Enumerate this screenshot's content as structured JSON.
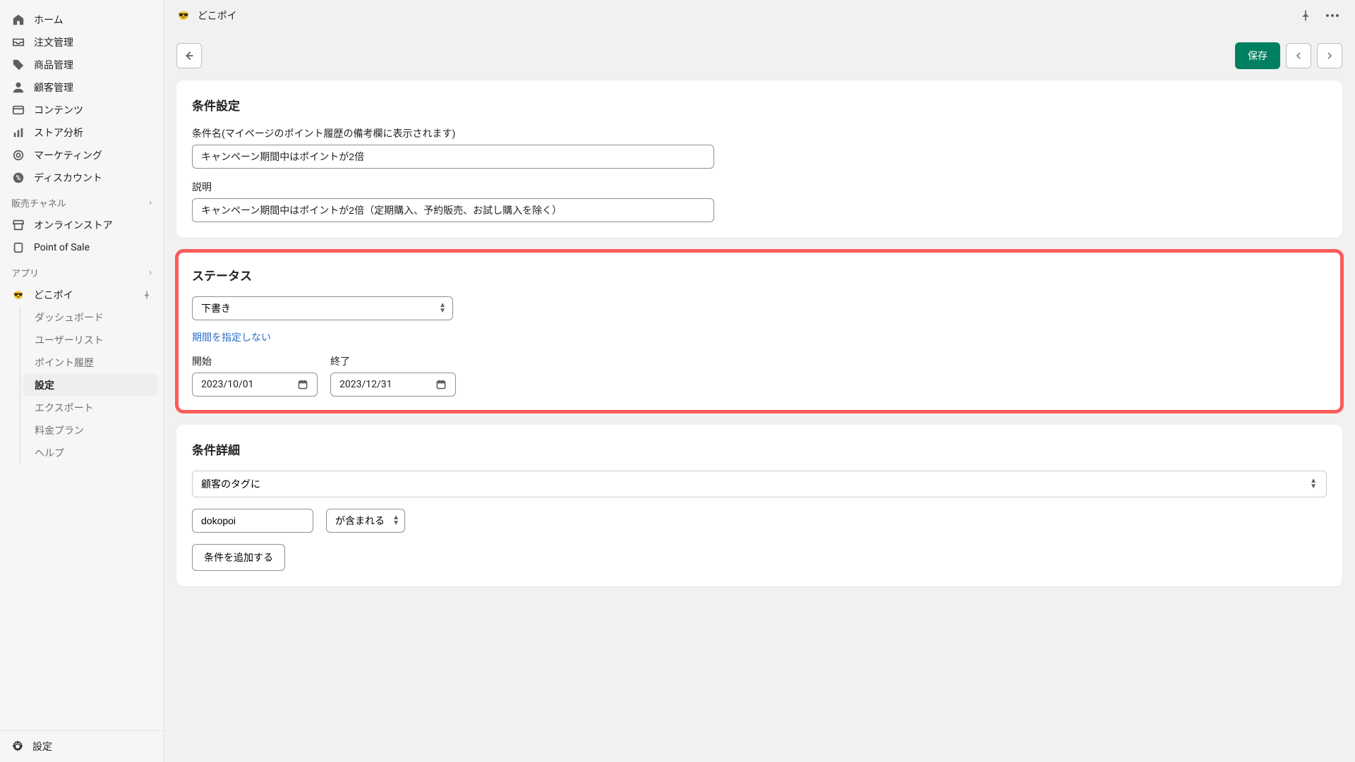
{
  "sidebar": {
    "main_items": [
      {
        "icon": "home",
        "label": "ホーム"
      },
      {
        "icon": "inbox",
        "label": "注文管理"
      },
      {
        "icon": "tag",
        "label": "商品管理"
      },
      {
        "icon": "user",
        "label": "顧客管理"
      },
      {
        "icon": "content",
        "label": "コンテンツ"
      },
      {
        "icon": "chart",
        "label": "ストア分析"
      },
      {
        "icon": "target",
        "label": "マーケティング"
      },
      {
        "icon": "discount",
        "label": "ディスカウント"
      }
    ],
    "channels_header": "販売チャネル",
    "channels": [
      {
        "icon": "store",
        "label": "オンラインストア"
      },
      {
        "icon": "pos",
        "label": "Point of Sale"
      }
    ],
    "apps_header": "アプリ",
    "app_name": "どこポイ",
    "app_subitems": [
      {
        "label": "ダッシュボード",
        "active": false
      },
      {
        "label": "ユーザーリスト",
        "active": false
      },
      {
        "label": "ポイント履歴",
        "active": false
      },
      {
        "label": "設定",
        "active": true
      },
      {
        "label": "エクスポート",
        "active": false
      },
      {
        "label": "料金プラン",
        "active": false
      },
      {
        "label": "ヘルプ",
        "active": false
      }
    ],
    "settings_label": "設定"
  },
  "topbar": {
    "app_title": "どこポイ"
  },
  "toolbar": {
    "save_label": "保存"
  },
  "card_condition": {
    "title": "条件設定",
    "name_label": "条件名(マイページのポイント履歴の備考欄に表示されます)",
    "name_value": "キャンペーン期間中はポイントが2倍",
    "desc_label": "説明",
    "desc_value": "キャンペーン期間中はポイントが2倍（定期購入、予約販売、お試し購入を除く）"
  },
  "card_status": {
    "title": "ステータス",
    "status_value": "下書き",
    "no_period_link": "期間を指定しない",
    "start_label": "開始",
    "start_value": "2023/10/01",
    "end_label": "終了",
    "end_value": "2023/12/31"
  },
  "card_detail": {
    "title": "条件詳細",
    "target_value": "顧客のタグに",
    "tag_value": "dokopoi",
    "contains_value": "が含まれる",
    "add_button": "条件を追加する"
  }
}
